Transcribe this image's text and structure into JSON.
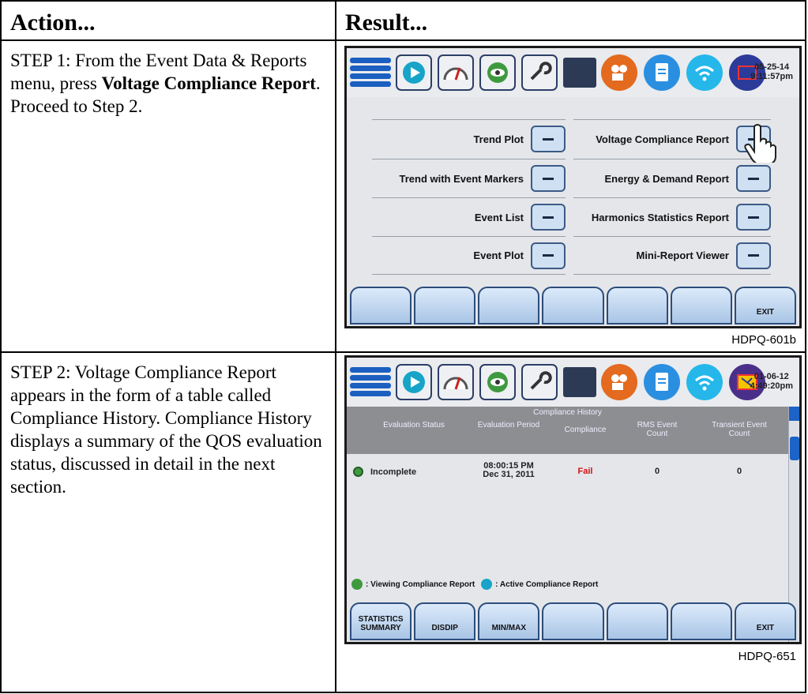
{
  "headers": {
    "action": "Action...",
    "result": "Result..."
  },
  "step1": {
    "pre": "STEP 1: From the Event Data & Reports menu, press ",
    "bold": "Voltage Compliance Report",
    "post": ". Proceed to Step 2.",
    "caption": "HDPQ-601b",
    "clock": {
      "date": "05-25-14",
      "time": "9:11:57pm"
    },
    "menu_left": [
      "Trend Plot",
      "Trend with Event Markers",
      "Event List",
      "Event Plot"
    ],
    "menu_right": [
      "Voltage Compliance Report",
      "Energy & Demand Report",
      "Harmonics Statistics Report",
      "Mini-Report Viewer"
    ],
    "softkeys": [
      "",
      "",
      "",
      "",
      "",
      "",
      "EXIT"
    ]
  },
  "step2": {
    "text": "STEP 2: Voltage Compliance Report appears in the form of a table called Compliance History. Compliance History displays a summary of the QOS evaluation status, discussed in detail in the next section.",
    "caption": "HDPQ-651",
    "clock": {
      "date": "01-06-12",
      "time": "4:49:20pm"
    },
    "table_title": "Compliance History",
    "columns": [
      "Evaluation Status",
      "Evaluation Period",
      "Compliance",
      "RMS Event Count",
      "Transient Event Count"
    ],
    "row": {
      "status": "Incomplete",
      "period_time": "08:00:15 PM",
      "period_date": "Dec 31, 2011",
      "compliance": "Fail",
      "rms": "0",
      "transient": "0"
    },
    "legend_viewing": ": Viewing Compliance Report",
    "legend_active": ": Active Compliance Report",
    "softkeys": [
      "STATISTICS SUMMARY",
      "DISDIP",
      "MIN/MAX",
      "",
      "",
      "",
      "EXIT"
    ]
  },
  "colors": {
    "accent_blue": "#1b63c6",
    "fail_red": "#d01010",
    "grey_header": "#8c8e92"
  }
}
